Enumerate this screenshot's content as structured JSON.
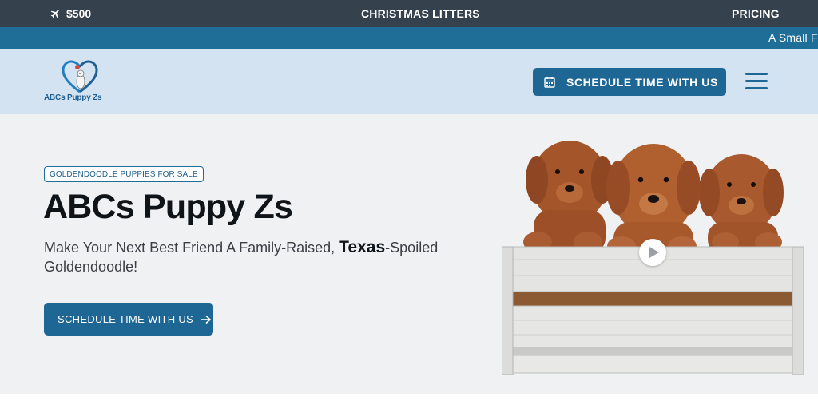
{
  "topbar": {
    "left_icon": "airplane-icon",
    "left_text": "$500",
    "center_text": "CHRISTMAS LITTERS",
    "right_text": "PRICING"
  },
  "ticker": {
    "text": "A Small F"
  },
  "header": {
    "logo_text": "ABCs Puppy Zs",
    "schedule_button_label": "SCHEDULE TIME WITH US",
    "schedule_icon": "calendar-icon",
    "menu_icon": "hamburger-menu-icon"
  },
  "hero": {
    "tag": "GOLDENDOODLE PUPPIES FOR SALE",
    "title": "ABCs Puppy Zs",
    "subtitle_before": "Make Your Next Best Friend A Family-Raised, ",
    "subtitle_bold": "Texas",
    "subtitle_after": "-Spoiled Goldendoodle!",
    "cta_label": "SCHEDULE TIME WITH US",
    "cta_icon": "arrow-right-icon",
    "play_icon": "play-icon"
  },
  "colors": {
    "topbar": "#35414d",
    "ticker": "#1e6e98",
    "header": "#d4e3f1",
    "button": "#1e6694",
    "hero_bg": "#f0f1f3"
  }
}
